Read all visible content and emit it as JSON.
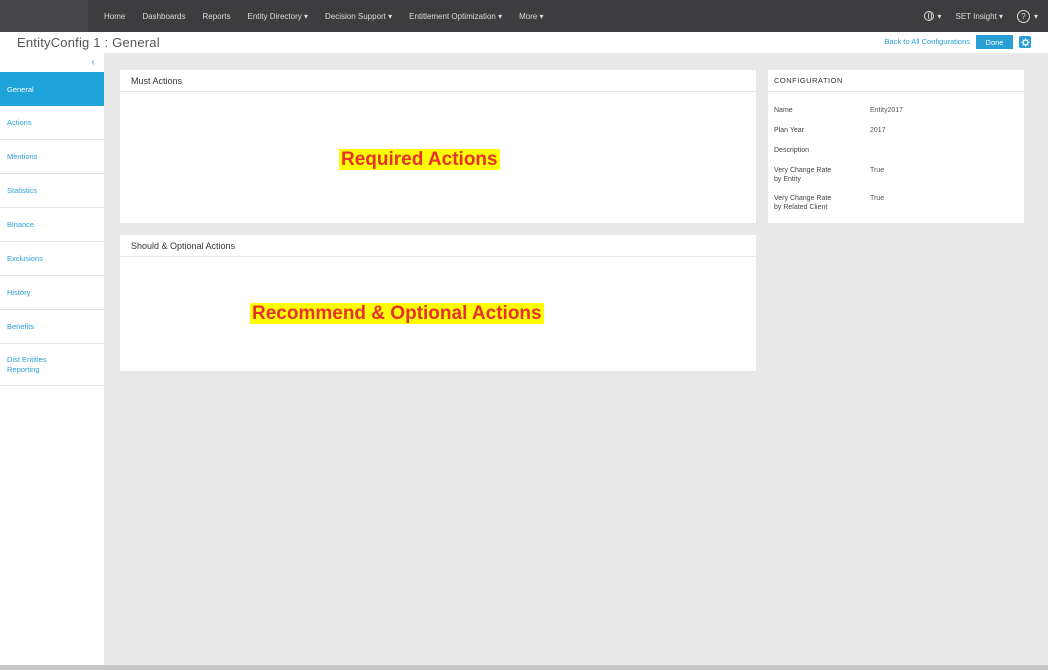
{
  "topnav": {
    "items": [
      "Home",
      "Dashboards",
      "Reports",
      "Entity Directory ▾",
      "Decision Support ▾",
      "Entitlement Optimization ▾",
      "More ▾"
    ]
  },
  "topright": {
    "language": "▾",
    "user": "SET Insight ▾",
    "help": "?",
    "help_caret": "▾"
  },
  "titlebar": {
    "title": "EntityConfig 1 : General",
    "back_link": "Back to All Configurations",
    "done": "Done"
  },
  "sidebar": {
    "collapse": "‹",
    "items": [
      "General",
      "Actions",
      "Mentions",
      "Statistics",
      "Binance",
      "Exclusions",
      "History",
      "Benefits",
      "Dist Entities\nReporting"
    ]
  },
  "required_panel": {
    "header": "Must Actions",
    "highlight": "Required Actions"
  },
  "optional_panel": {
    "header": "Should & Optional Actions",
    "highlight": "Recommend & Optional Actions"
  },
  "info_panel": {
    "header": "CONFIGURATION",
    "rows": [
      {
        "key": "Name",
        "value": "Entity2017"
      },
      {
        "key": "Plan Year",
        "value": "2017"
      },
      {
        "key": "Description",
        "value": ""
      },
      {
        "key": "Very Change Rate\nby Entity",
        "value": "True"
      },
      {
        "key": "Very Change Rate\nby Related Client",
        "value": "True"
      }
    ]
  },
  "colors": {
    "accent": "#2a9fd6",
    "topbar": "#3d3d3f",
    "highlight_bg": "#ffff00",
    "highlight_text": "#e83030"
  }
}
